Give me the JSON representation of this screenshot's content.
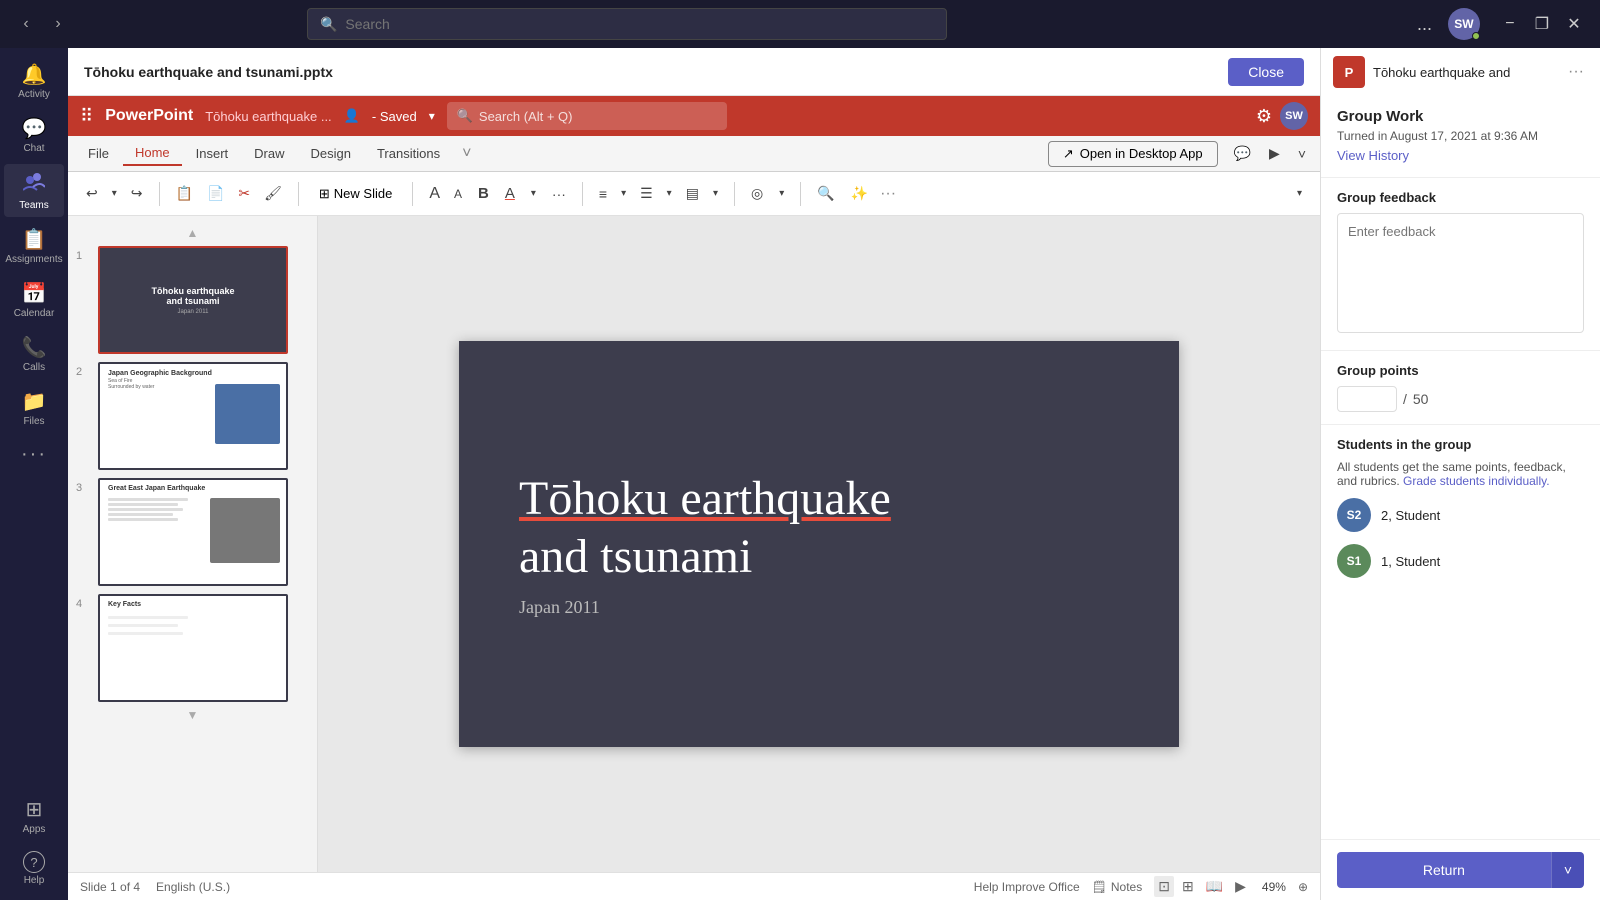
{
  "topBar": {
    "search_placeholder": "Search",
    "avatar_initials": "SW",
    "more_options_label": "...",
    "minimize_label": "−",
    "maximize_label": "❐",
    "close_label": "✕"
  },
  "sidebar": {
    "items": [
      {
        "id": "activity",
        "label": "Activity",
        "icon": "🔔"
      },
      {
        "id": "chat",
        "label": "Chat",
        "icon": "💬"
      },
      {
        "id": "teams",
        "label": "Teams",
        "icon": "👥"
      },
      {
        "id": "assignments",
        "label": "Assignments",
        "icon": "📋"
      },
      {
        "id": "calendar",
        "label": "Calendar",
        "icon": "📅"
      },
      {
        "id": "calls",
        "label": "Calls",
        "icon": "📞"
      },
      {
        "id": "files",
        "label": "Files",
        "icon": "📁"
      },
      {
        "id": "more",
        "label": "···",
        "icon": "···"
      },
      {
        "id": "apps",
        "label": "Apps",
        "icon": "⊞"
      },
      {
        "id": "help",
        "label": "Help",
        "icon": "?"
      }
    ]
  },
  "fileHeader": {
    "title": "Tōhoku earthquake and tsunami.pptx",
    "close_label": "Close"
  },
  "powerpoint": {
    "brand": "PowerPoint",
    "filename": "Tōhoku earthquake ...",
    "saved_label": "- Saved",
    "search_placeholder": "Search (Alt + Q)",
    "tabs": [
      {
        "id": "file",
        "label": "File"
      },
      {
        "id": "home",
        "label": "Home"
      },
      {
        "id": "insert",
        "label": "Insert"
      },
      {
        "id": "draw",
        "label": "Draw"
      },
      {
        "id": "design",
        "label": "Design"
      },
      {
        "id": "transitions",
        "label": "Transitions"
      }
    ],
    "more_tabs_label": "˅",
    "open_desktop_label": "Open in Desktop App",
    "toolbar": {
      "new_slide_label": "New Slide"
    }
  },
  "slide": {
    "current_num": 1,
    "total": 4,
    "language": "English (U.S.)",
    "title": "Tōhoku earthquake and tsunami",
    "title_part1": "Tōhoku earthquake",
    "title_part2": "and tsunami",
    "year": "Japan 2011",
    "zoom": "49%"
  },
  "slideThumbnails": [
    {
      "num": "1",
      "title": "Tōhoku earthquake and tsunami",
      "subtitle": "Japan 2011"
    },
    {
      "num": "2",
      "title": "Japan Geographic Background"
    },
    {
      "num": "3",
      "title": "Great East Japan Earthquake"
    },
    {
      "num": "4",
      "title": "Key Facts"
    }
  ],
  "statusBar": {
    "slide_info": "Slide 1 of 4",
    "language": "English (U.S.)",
    "help_improve": "Help Improve Office",
    "notes_label": "Notes",
    "zoom_label": "49%"
  },
  "rightPanel": {
    "ppt_icon_label": "P",
    "filename": "Tōhoku earthquake and",
    "more_label": "···",
    "group_work": {
      "title": "Group Work",
      "submitted": "Turned in August 17, 2021 at 9:36 AM",
      "history_link": "View History"
    },
    "group_feedback": {
      "label": "Group feedback",
      "placeholder": "Enter feedback"
    },
    "group_points": {
      "label": "Group points",
      "input_value": "",
      "max": "50"
    },
    "students": {
      "label": "Students in the group",
      "description": "All students get the same points, feedback, and rubrics.",
      "grade_link": "Grade students individually.",
      "list": [
        {
          "id": "s2",
          "initials": "S2",
          "name": "2, Student",
          "color": "#4a6fa5"
        },
        {
          "id": "s1",
          "initials": "S1",
          "name": "1, Student",
          "color": "#5b8a5b"
        }
      ]
    },
    "return_label": "Return",
    "return_chevron": "˅"
  }
}
